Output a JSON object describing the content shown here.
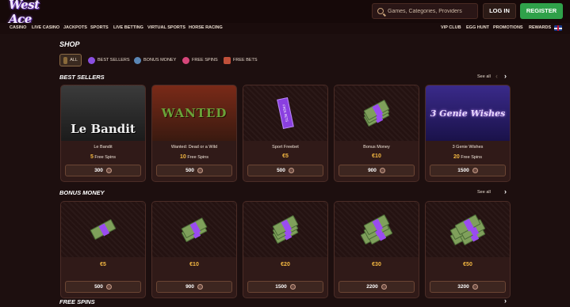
{
  "header": {
    "logo_text": "West Ace",
    "search_placeholder": "Games, Categories, Providers",
    "login_label": "LOG IN",
    "register_label": "REGISTER"
  },
  "nav": {
    "left": [
      "CASINO",
      "LIVE CASINO",
      "JACKPOTS",
      "SPORTS",
      "LIVE BETTING",
      "VIRTUAL SPORTS",
      "HORSE RACING"
    ],
    "right": [
      "VIP CLUB",
      "EGG HUNT",
      "PROMOTIONS",
      "REWARDS"
    ]
  },
  "shop": {
    "title": "SHOP",
    "filters": [
      "ALL",
      "BEST SELLERS",
      "BONUS MONEY",
      "FREE SPINS",
      "FREE BETS"
    ],
    "active_filter": "ALL"
  },
  "sections": [
    {
      "title": "BEST SELLERS",
      "see_all": "See all",
      "cards": [
        {
          "name": "Le Bandit",
          "amount": "5",
          "unit": "Free Spins",
          "price": "300",
          "art": "Le Bandit"
        },
        {
          "name": "Wanted: Dead or a Wild",
          "amount": "10",
          "unit": "Free Spins",
          "price": "500",
          "art": "WANTED"
        },
        {
          "name": "Sport Freebet",
          "value": "€5",
          "price": "500",
          "art": "FREE BETS"
        },
        {
          "name": "Bonus Money",
          "value": "€10",
          "price": "900"
        },
        {
          "name": "3 Genie Wishes",
          "amount": "20",
          "unit": "Free Spins",
          "price": "1500",
          "art": "3 Genie Wishes"
        }
      ]
    },
    {
      "title": "BONUS MONEY",
      "see_all": "See all",
      "cards": [
        {
          "value": "€5",
          "price": "500"
        },
        {
          "value": "€10",
          "price": "900"
        },
        {
          "value": "€20",
          "price": "1500"
        },
        {
          "value": "€30",
          "price": "2200"
        },
        {
          "value": "€50",
          "price": "3200"
        }
      ]
    },
    {
      "title": "FREE SPINS"
    }
  ],
  "colors": {
    "background": "#1d0f0f",
    "card": "#301a18",
    "accent_gold": "#f5b942",
    "register_green": "#2fa14a"
  }
}
